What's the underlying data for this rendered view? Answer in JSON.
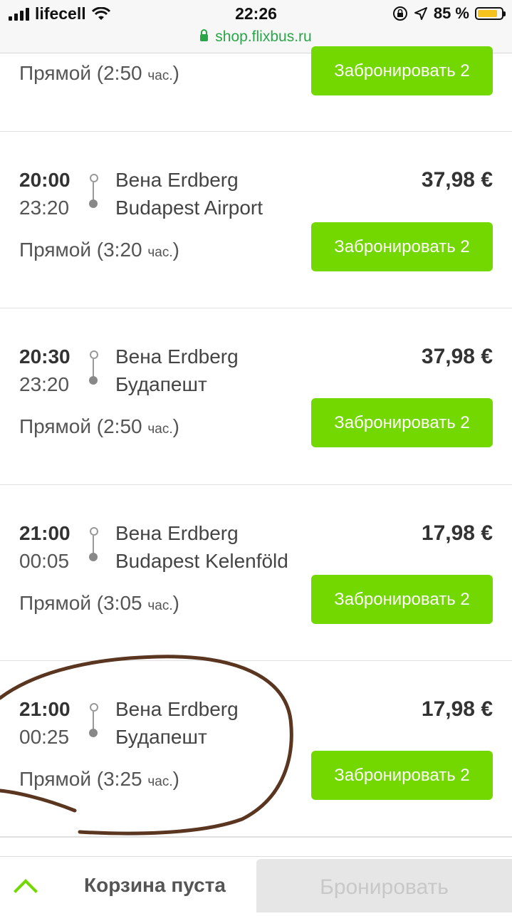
{
  "status_bar": {
    "carrier": "lifecell",
    "time": "22:26",
    "battery_pct": "85 %",
    "url": "shop.flixbus.ru"
  },
  "trips": [
    {
      "departure": "",
      "arrival": "",
      "from": "",
      "to": "",
      "price": "",
      "duration": "Прямой (2:50",
      "duration_unit": "час.",
      "duration_close": ")",
      "button": "Забронировать 2"
    },
    {
      "departure": "20:00",
      "arrival": "23:20",
      "from": "Вена Erdberg",
      "to": "Budapest Airport",
      "price": "37,98 €",
      "duration": "Прямой (3:20",
      "duration_unit": "час.",
      "duration_close": ")",
      "button": "Забронировать 2"
    },
    {
      "departure": "20:30",
      "arrival": "23:20",
      "from": "Вена Erdberg",
      "to": "Будапешт",
      "price": "37,98 €",
      "duration": "Прямой (2:50",
      "duration_unit": "час.",
      "duration_close": ")",
      "button": "Забронировать 2"
    },
    {
      "departure": "21:00",
      "arrival": "00:05",
      "from": "Вена Erdberg",
      "to": "Budapest Kelenföld",
      "price": "17,98 €",
      "duration": "Прямой (3:05",
      "duration_unit": "час.",
      "duration_close": ")",
      "button": "Забронировать 2"
    },
    {
      "departure": "21:00",
      "arrival": "00:25",
      "from": "Вена Erdberg",
      "to": "Будапешт",
      "price": "17,98 €",
      "duration": "Прямой (3:25",
      "duration_unit": "час.",
      "duration_close": ")",
      "button": "Забронировать 2"
    }
  ],
  "bottom_bar": {
    "cart_label": "Корзина пуста",
    "book_label": "Бронировать"
  },
  "colors": {
    "accent": "#73d700",
    "scribble": "#5a3520"
  }
}
